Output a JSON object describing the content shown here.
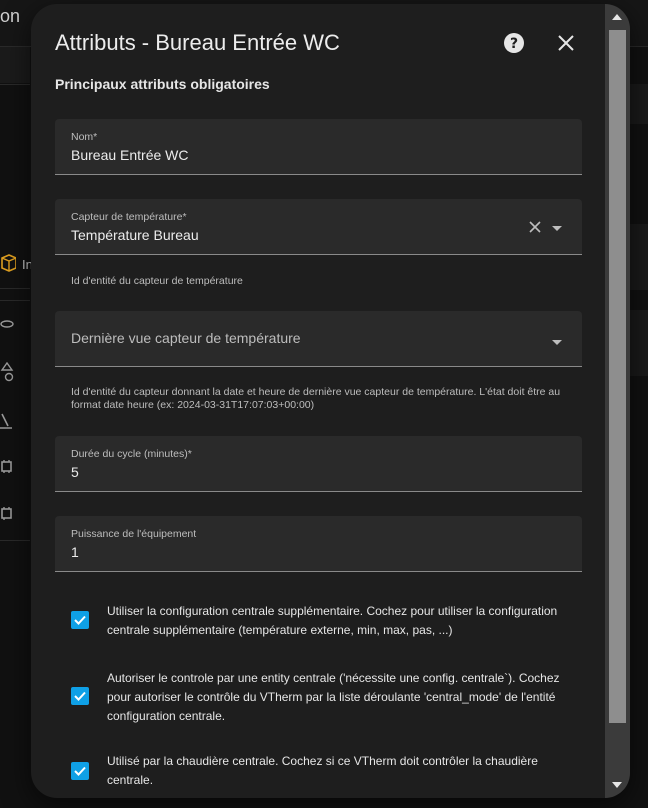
{
  "background": {
    "app_title": "on",
    "sidebar_label": "In"
  },
  "dialog": {
    "title": "Attributs - Bureau Entrée WC",
    "section_title": "Principaux attributs obligatoires",
    "fields": {
      "name": {
        "label": "Nom*",
        "value": "Bureau Entrée WC"
      },
      "temp_sensor": {
        "label": "Capteur de température*",
        "value": "Température Bureau",
        "helper": "Id d'entité du capteur de température"
      },
      "last_seen": {
        "placeholder": "Dernière vue capteur de température",
        "helper": "Id d'entité du capteur donnant la date et heure de dernière vue capteur de température. L'état doit être au format date heure (ex: 2024-03-31T17:07:03+00:00)"
      },
      "cycle": {
        "label": "Durée du cycle (minutes)*",
        "value": "5"
      },
      "power": {
        "label": "Puissance de l'équipement",
        "value": "1"
      }
    },
    "checkboxes": [
      {
        "text": "Utiliser la configuration centrale supplémentaire. Cochez pour utiliser la configuration centrale supplémentaire (température externe, min, max, pas, ...)",
        "checked": true
      },
      {
        "text": "Autoriser le controle par une entity centrale ('nécessite une config. centrale`). Cochez pour autoriser le contrôle du VTherm par la liste déroulante 'central_mode' de l'entité configuration centrale.",
        "checked": true
      },
      {
        "text": "Utilisé par la chaudière centrale. Cochez si ce VTherm doit contrôler la chaudière centrale.",
        "checked": true
      }
    ]
  },
  "icons": {
    "help": "help-circle-icon",
    "close": "close-icon",
    "clear": "clear-x-icon",
    "dropdown": "chevron-down-icon",
    "check": "checkmark-icon"
  },
  "colors": {
    "accent": "#0fa0e6",
    "dialog_bg": "#1e1e1e",
    "field_bg": "#2a2a2a"
  }
}
